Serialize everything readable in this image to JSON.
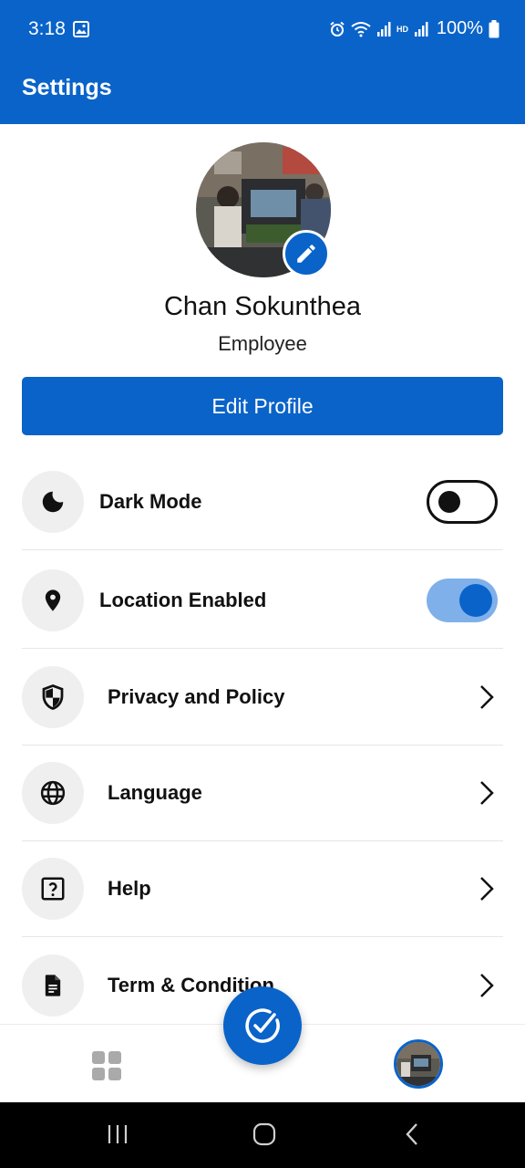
{
  "status_bar": {
    "time": "3:18",
    "battery": "100%"
  },
  "app_bar": {
    "title": "Settings"
  },
  "profile": {
    "name": "Chan Sokunthea",
    "role": "Employee",
    "edit_button": "Edit Profile"
  },
  "settings": [
    {
      "label": "Dark Mode",
      "icon": "moon-icon",
      "control": "toggle",
      "enabled": false
    },
    {
      "label": "Location Enabled",
      "icon": "location-pin-icon",
      "control": "toggle",
      "enabled": true
    },
    {
      "label": "Privacy and Policy",
      "icon": "shield-icon",
      "control": "chevron"
    },
    {
      "label": "Language",
      "icon": "globe-icon",
      "control": "chevron"
    },
    {
      "label": "Help",
      "icon": "help-icon",
      "control": "chevron"
    },
    {
      "label": "Term & Condition",
      "icon": "document-icon",
      "control": "chevron"
    }
  ],
  "colors": {
    "primary": "#0a63c9",
    "toggle_track_on": "#7fb0ea",
    "icon_bg": "#efefef"
  }
}
